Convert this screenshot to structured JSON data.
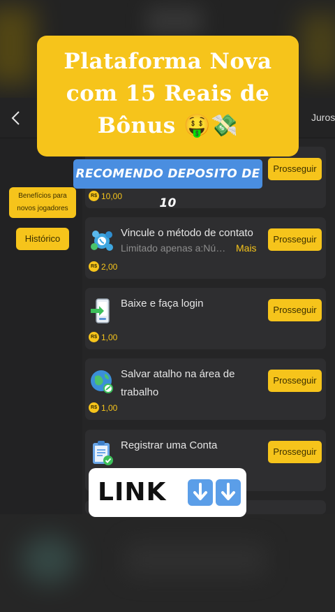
{
  "header": {
    "back_icon": "chevron-left-icon",
    "right_label": "Juros"
  },
  "sidebar": {
    "item1": "Benefícios para novos jogadores",
    "item2": "Histórico"
  },
  "tasks": [
    {
      "title": "",
      "subtitle": "",
      "more": "",
      "button": "Prosseguir",
      "reward": "10,00",
      "icon": "hidden-icon"
    },
    {
      "title": "Vincule o método de contato",
      "subtitle": "Limitado apenas a:Nú…",
      "more": "Mais",
      "button": "Prosseguir",
      "reward": "2,00",
      "icon": "contact-apps-icon"
    },
    {
      "title": "Baixe e faça login",
      "subtitle": "",
      "more": "",
      "button": "Prosseguir",
      "reward": "1,00",
      "icon": "phone-download-icon"
    },
    {
      "title": "Salvar atalho na área de trabalho",
      "subtitle": "",
      "more": "",
      "button": "Prosseguir",
      "reward": "1,00",
      "icon": "globe-link-icon"
    },
    {
      "title": "Registrar uma Conta",
      "subtitle": "",
      "more": "",
      "button": "Prosseguir",
      "reward": "",
      "icon": "clipboard-check-icon"
    }
  ],
  "currency_symbol": "R$",
  "overlay": {
    "banner": "Plataforma Nova com 15 Reais de Bônus 🤑💸",
    "tag": "RECOMENDO DEPOSITO DE 10",
    "link": "LINK"
  },
  "colors": {
    "accent": "#f6c41b",
    "background": "#252526",
    "card": "#2e2e30",
    "tag": "#4a8ee0"
  }
}
